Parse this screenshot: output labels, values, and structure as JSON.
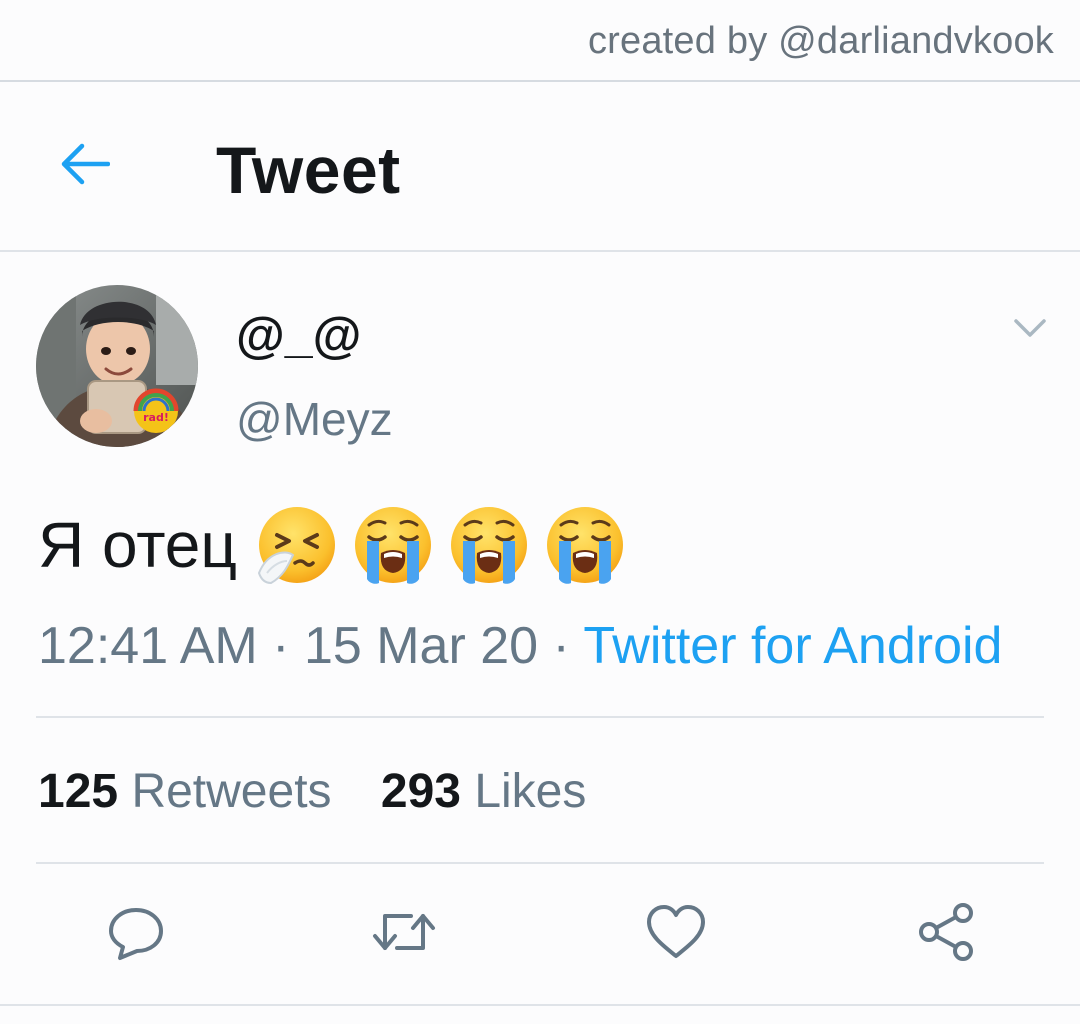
{
  "watermark": {
    "text": "created by @darliandvkook"
  },
  "header": {
    "title": "Tweet",
    "back_icon": "arrow-left-icon"
  },
  "tweet": {
    "display_name": "@_@",
    "handle": "@Meyz",
    "text": "Я отец",
    "emojis": [
      "sneezing-face",
      "loudly-crying-face",
      "loudly-crying-face",
      "loudly-crying-face"
    ],
    "time": "12:41 AM",
    "date": "15 Mar 20",
    "source": "Twitter for Android",
    "separator": "·",
    "avatar_sticker_text": "totally rad!"
  },
  "stats": {
    "retweets_count": "125",
    "retweets_label": "Retweets",
    "likes_count": "293",
    "likes_label": "Likes"
  },
  "actions": [
    "reply-icon",
    "retweet-icon",
    "like-icon",
    "share-icon"
  ],
  "colors": {
    "accent": "#1da1f2",
    "secondary_text": "#657786",
    "primary_text": "#14171a",
    "divider": "#dfe3e8",
    "icon": "#657786"
  }
}
